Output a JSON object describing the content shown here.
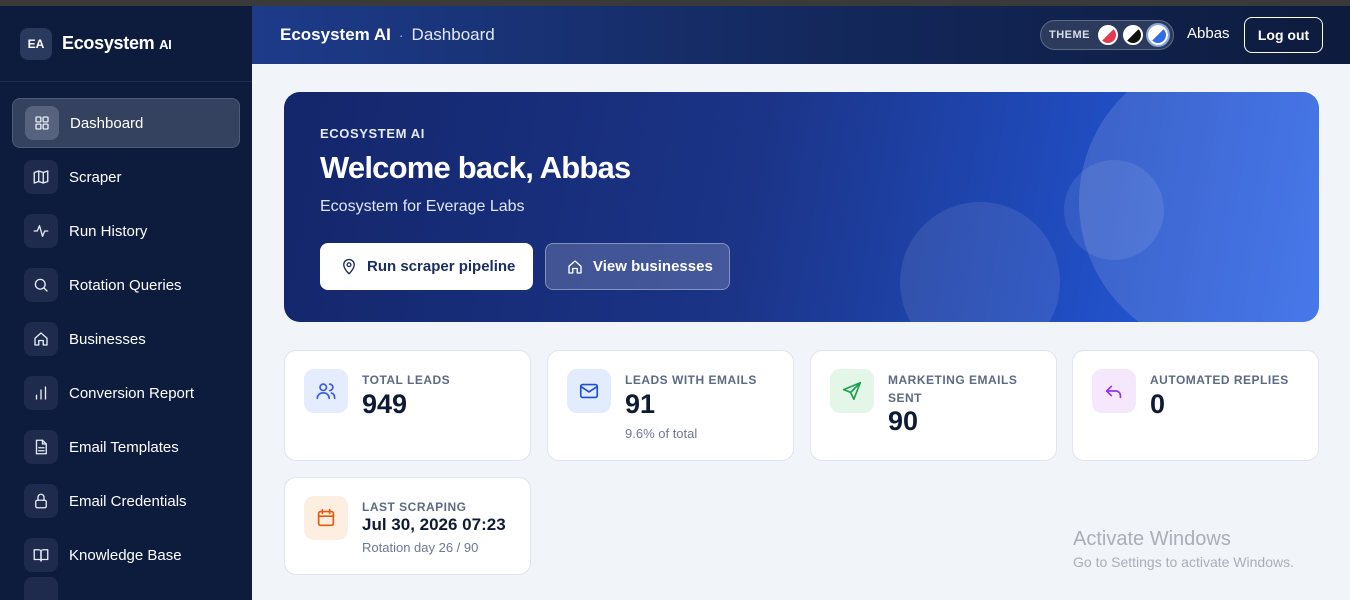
{
  "brand": {
    "badge": "EA",
    "name": "Ecosystem",
    "name_suffix": "AI"
  },
  "sidebar": {
    "items": [
      {
        "label": "Dashboard",
        "icon": "grid-icon",
        "active": true
      },
      {
        "label": "Scraper",
        "icon": "map-icon"
      },
      {
        "label": "Run History",
        "icon": "activity-icon"
      },
      {
        "label": "Rotation Queries",
        "icon": "search-icon"
      },
      {
        "label": "Businesses",
        "icon": "home-icon"
      },
      {
        "label": "Conversion Report",
        "icon": "bar-chart-icon"
      },
      {
        "label": "Email Templates",
        "icon": "file-text-icon"
      },
      {
        "label": "Email Credentials",
        "icon": "lock-icon"
      },
      {
        "label": "Knowledge Base",
        "icon": "book-open-icon"
      }
    ]
  },
  "header": {
    "app": "Ecosystem AI",
    "separator": "·",
    "page": "Dashboard",
    "theme_label": "THEME",
    "theme_options": [
      "red",
      "black",
      "blue"
    ],
    "theme_selected": "blue",
    "user": "Abbas",
    "logout_label": "Log out"
  },
  "hero": {
    "kicker": "ECOSYSTEM AI",
    "title": "Welcome back, Abbas",
    "subtitle": "Ecosystem for Everage Labs",
    "primary_button": "Run scraper pipeline",
    "secondary_button": "View businesses"
  },
  "stats": {
    "total_leads": {
      "label": "TOTAL LEADS",
      "value": "949",
      "icon": "users-icon",
      "color": "#3b5bdb"
    },
    "leads_with_emails": {
      "label": "LEADS WITH EMAILS",
      "value": "91",
      "note": "9.6% of total",
      "icon": "mail-icon",
      "color": "#1c4fd8"
    },
    "marketing_emails": {
      "label": "MARKETING EMAILS SENT",
      "value": "90",
      "icon": "send-icon",
      "color": "#16a34a"
    },
    "automated_replies": {
      "label": "AUTOMATED REPLIES",
      "value": "0",
      "icon": "reply-icon",
      "color": "#9333ea"
    },
    "last_scraping": {
      "label": "LAST SCRAPING",
      "value": "Jul 30, 2026 07:23",
      "note": "Rotation day 26 / 90",
      "icon": "calendar-icon",
      "color": "#ea580c"
    }
  },
  "watermark": {
    "line1": "Activate Windows",
    "line2": "Go to Settings to activate Windows."
  }
}
